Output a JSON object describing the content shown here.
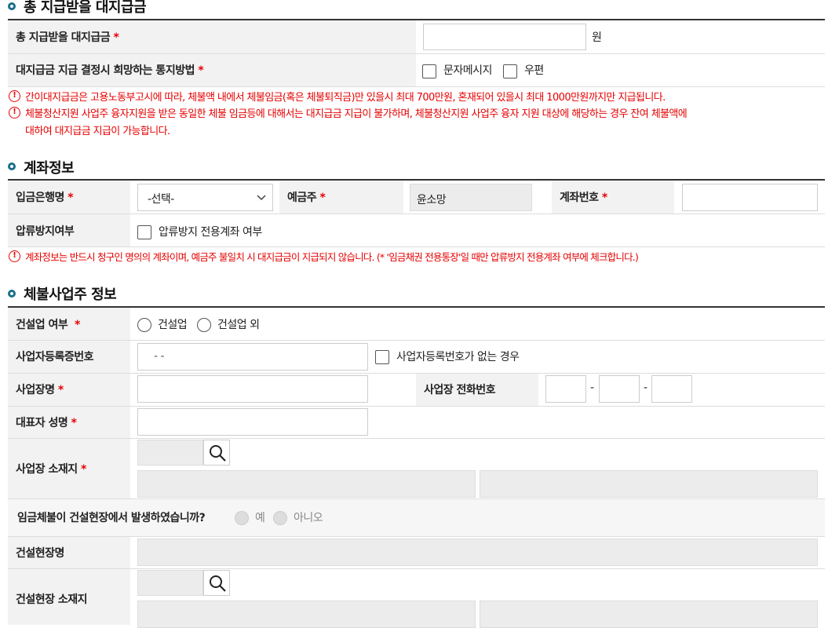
{
  "sections": {
    "total": {
      "title": "총 지급받을 대지급금",
      "row1_label": "총 지급받을 대지급금",
      "row1_unit": "원",
      "row2_label": "대지급금 지급 결정시 희망하는 통지방법",
      "notify_sms": "문자메시지",
      "notify_mail": "우편",
      "warnings": [
        "간이대지급금은 고용노동부고시에 따라, 체불액 내에서 체불임금(혹은 체불퇴직금)만 있을시 최대 700만원, 혼재되어 있을시 최대 1000만원까지만 지급됩니다.",
        "체불청산지원 사업주 융자지원을 받은 동일한 체불 임금등에 대해서는 대지급금 지급이 불가하며, 체불청산지원  사업주 융자 지원 대상에 해당하는 경우 잔여 체불액에",
        "대하여 대지급금 지급이 가능합니다."
      ]
    },
    "account": {
      "title": "계좌정보",
      "bank_label": "입금은행명",
      "bank_selected": "-선택-",
      "holder_label": "예금주",
      "holder_value": "윤소망",
      "number_label": "계좌번호",
      "seizure_label": "압류방지여부",
      "seizure_option": "압류방지 전용계좌 여부",
      "warning": "계좌정보는 반드시 청구인 명의의 계좌이며, 예금주 불일치 시 대지급금이 지급되지 않습니다. (* '임금채권 전용통장'일 때만 압류방지 전용계좌 여부에 체크합니다.)"
    },
    "employer": {
      "title": "체불사업주 정보",
      "construction_label": "건설업 여부",
      "construction_yes": "건설업",
      "construction_no": "건설업 외",
      "bizno_label": "사업자등록증번호",
      "bizno_value": "-  -",
      "bizno_none": "사업자등록번호가 없는 경우",
      "bizname_label": "사업장명",
      "phone_label": "사업장 전화번호",
      "phone_sep": "-",
      "ceo_label": "대표자 성명",
      "address_label": "사업장 소재지",
      "site_question": "임금체불이 건설현장에서 발생하였습니까?",
      "site_yes": "예",
      "site_no": "아니오",
      "site_name_label": "건설현장명",
      "site_address_label": "건설현장 소재지"
    }
  },
  "required_mark": "*",
  "colors": {
    "accent": "#1a6f8a",
    "required": "#e60000",
    "label_bg": "#f2f2f2"
  },
  "icons": [
    "circle-dot-icon",
    "alert-icon",
    "search-icon",
    "chevron-down-icon"
  ]
}
